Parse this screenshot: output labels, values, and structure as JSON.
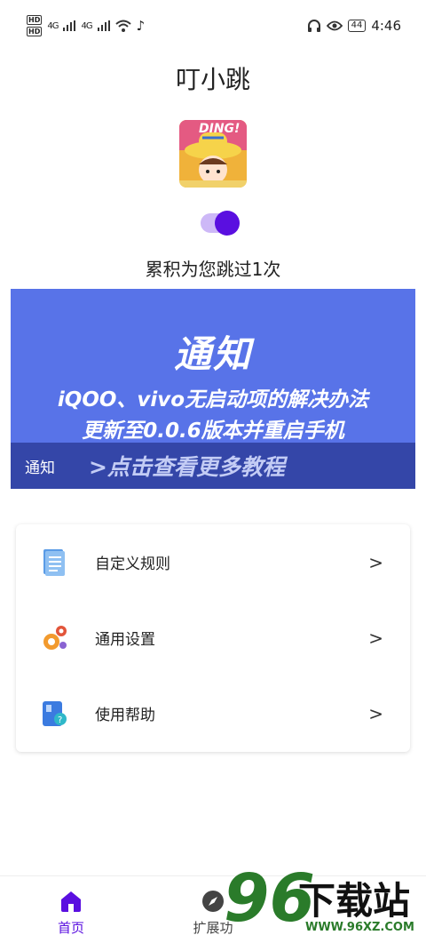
{
  "status_bar": {
    "hd1": "HD",
    "hd2": "HD",
    "net1": "4G",
    "net2": "4G",
    "battery": "44",
    "time": "4:46"
  },
  "app": {
    "title": "叮小跳",
    "icon_text": "DING!",
    "toggle_on": true,
    "counter_text": "累积为您跳过1次"
  },
  "banner": {
    "title": "通知",
    "line1": "iQOO、vivo无启动项的解决办法",
    "line2": "更新至0.0.6版本并重启手机",
    "tag": "通知",
    "more_link": ">点击查看更多教程",
    "colors": {
      "bg": "#5873e8",
      "footer": "#3446a8"
    }
  },
  "menu": {
    "items": [
      {
        "label": "自定义规则",
        "icon": "document-list-icon"
      },
      {
        "label": "通用设置",
        "icon": "gears-icon"
      },
      {
        "label": "使用帮助",
        "icon": "help-book-icon"
      }
    ]
  },
  "bottom_nav": {
    "items": [
      {
        "label": "首页",
        "icon": "home-icon",
        "active": true
      },
      {
        "label": "扩展功",
        "icon": "compass-icon",
        "active": false
      }
    ]
  },
  "watermark": {
    "number": "96",
    "text": "下载站",
    "url": "WWW.96XZ.COM"
  },
  "accent_color": "#5a0fe0"
}
